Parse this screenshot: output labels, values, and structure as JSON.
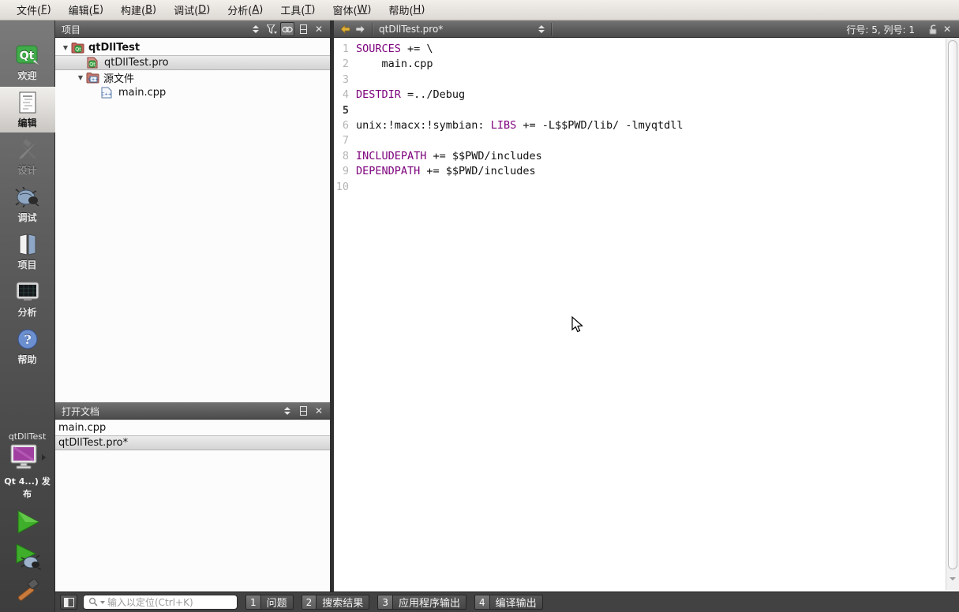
{
  "glyphs": {
    "close": "✕",
    "expanded": "▼"
  },
  "colors": {
    "keyword": "#7c007c",
    "qt_green": "#41cd52",
    "run_green": "#33a02c",
    "target_purple": "#a844a8",
    "header_gray": "#5a5a5a"
  },
  "menubar": {
    "items": [
      {
        "pre": "文件(",
        "key": "F",
        "post": ")"
      },
      {
        "pre": "编辑(",
        "key": "E",
        "post": ")"
      },
      {
        "pre": "构建(",
        "key": "B",
        "post": ")"
      },
      {
        "pre": "调试(",
        "key": "D",
        "post": ")"
      },
      {
        "pre": "分析(",
        "key": "A",
        "post": ")"
      },
      {
        "pre": "工具(",
        "key": "T",
        "post": ")"
      },
      {
        "pre": "窗体(",
        "key": "W",
        "post": ")"
      },
      {
        "pre": "帮助(",
        "key": "H",
        "post": ")"
      }
    ]
  },
  "sidebar": {
    "modes": [
      {
        "label": "欢迎"
      },
      {
        "label": "编辑"
      },
      {
        "label": "设计"
      },
      {
        "label": "调试"
      },
      {
        "label": "项目"
      },
      {
        "label": "分析"
      },
      {
        "label": "帮助"
      }
    ],
    "target_project": "qtDllTest",
    "target_kit": "Qt 4...) 发布"
  },
  "projects_pane": {
    "title": "项目",
    "tree": [
      {
        "label": "qtDllTest"
      },
      {
        "label": "qtDllTest.pro"
      },
      {
        "label": "源文件"
      },
      {
        "label": "main.cpp"
      }
    ]
  },
  "open_documents_pane": {
    "title": "打开文档",
    "items": [
      {
        "label": "main.cpp"
      },
      {
        "label": "qtDllTest.pro*"
      }
    ]
  },
  "editor": {
    "tab": "qtDllTest.pro*",
    "cursor_position": "行号: 5, 列号: 1",
    "lines": [
      {
        "num": "1",
        "kw": "SOURCES",
        "rest": " += \\"
      },
      {
        "num": "2",
        "plain": "    main.cpp"
      },
      {
        "num": "3"
      },
      {
        "num": "4",
        "kw": "DESTDIR",
        "rest": " =../Debug"
      },
      {
        "num": "5"
      },
      {
        "num": "6",
        "pre": "unix:!macx:!symbian: ",
        "kw": "LIBS",
        "rest": " += -L$$PWD/lib/ -lmyqtdll"
      },
      {
        "num": "7"
      },
      {
        "num": "8",
        "kw": "INCLUDEPATH",
        "rest": " += $$PWD/includes"
      },
      {
        "num": "9",
        "kw": "DEPENDPATH",
        "rest": " += $$PWD/includes"
      },
      {
        "num": "10"
      }
    ]
  },
  "bottombar": {
    "search_placeholder": "输入以定位(Ctrl+K)",
    "panes": [
      {
        "num": "1",
        "label": "问题"
      },
      {
        "num": "2",
        "label": "搜索结果"
      },
      {
        "num": "3",
        "label": "应用程序输出"
      },
      {
        "num": "4",
        "label": "编译输出"
      }
    ]
  }
}
